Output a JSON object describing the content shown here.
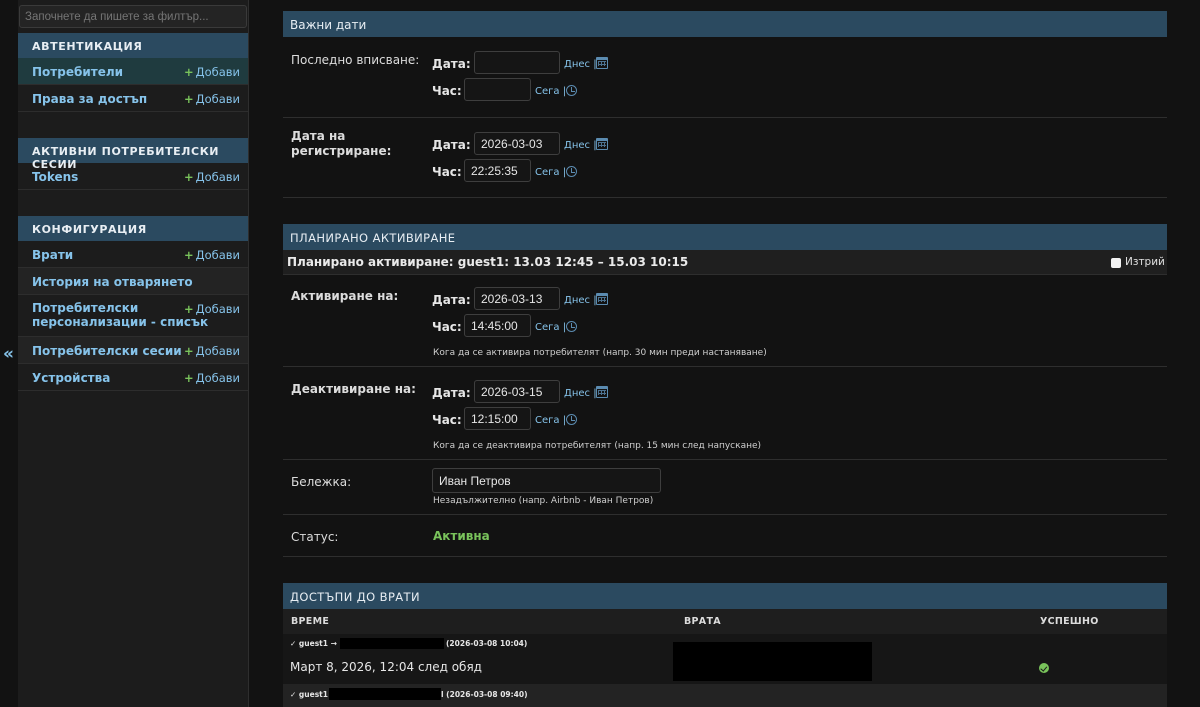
{
  "sidebar": {
    "filter_placeholder": "Започнете да пишете за филтър...",
    "collapse_label": "«",
    "add_label": "Добави",
    "modules": [
      {
        "title": "АВТЕНТИКАЦИЯ",
        "items": [
          {
            "label": "Потребители",
            "selected": true
          },
          {
            "label": "Права за достъп"
          }
        ]
      },
      {
        "title": "АКТИВНИ ПОТРЕБИТЕЛСКИ СЕСИИ",
        "items": [
          {
            "label": "Tokens"
          }
        ]
      },
      {
        "title": "КОНФИГУРАЦИЯ",
        "items": [
          {
            "label": "Врати"
          },
          {
            "label": "История на отварянето"
          },
          {
            "label_line1": "Потребителски",
            "label_line2": "персонализации - списък"
          },
          {
            "label": "Потребителски сесии"
          },
          {
            "label": "Устройства"
          }
        ]
      }
    ]
  },
  "important_dates": {
    "title": "Важни дати",
    "last_login": {
      "label": "Последно вписване:",
      "date_label": "Дата:",
      "date_value": "",
      "time_label": "Час:",
      "time_value": "",
      "today": "Днес",
      "now": "Сега",
      "sep": "|"
    },
    "date_joined": {
      "label_line1": "Дата на",
      "label_line2": "регистриране:",
      "date_label": "Дата:",
      "date_value": "2026-03-03",
      "time_label": "Час:",
      "time_value": "22:25:35",
      "today": "Днес",
      "now": "Сега",
      "sep": "|"
    }
  },
  "scheduled": {
    "title": "ПЛАНИРАНО АКТИВИРАНЕ",
    "entry_title": "Планирано активиране: guest1: 13.03 12:45 – 15.03 10:15",
    "delete_label": "Изтрий",
    "activate": {
      "label": "Активиране на:",
      "date_label": "Дата:",
      "date_value": "2026-03-13",
      "time_label": "Час:",
      "time_value": "14:45:00",
      "today": "Днес",
      "now": "Сега",
      "sep": "|",
      "help": "Кога да се активира потребителят (напр. 30 мин преди настаняване)"
    },
    "deactivate": {
      "label": "Деактивиране на:",
      "date_label": "Дата:",
      "date_value": "2026-03-15",
      "time_label": "Час:",
      "time_value": "12:15:00",
      "today": "Днес",
      "now": "Сега",
      "sep": "|",
      "help": "Кога да се деактивира потребителят (напр. 15 мин след напускане)"
    },
    "note": {
      "label": "Бележка:",
      "value": "Иван Петров",
      "help": "Незадължително (напр. Airbnb - Иван Петров)"
    },
    "status": {
      "label": "Статус:",
      "value": "Активна"
    }
  },
  "door_access": {
    "title": "ДОСТЪПИ ДО ВРАТИ",
    "columns": [
      "ВРЕМЕ",
      "ВРАТА",
      "УСПЕШНО"
    ],
    "rows": [
      {
        "prefix": "✓ guest1 →",
        "stamp": "(2026-03-08 10:04)",
        "time": "Март 8, 2026, 12:04 след обяд",
        "success": true
      },
      {
        "prefix": "✓ guest1 ·",
        "stamp": "l (2026-03-08 09:40)"
      }
    ]
  },
  "colors": {
    "accent": "#2b4a60",
    "link": "#86c3ea",
    "success": "#79c35b"
  }
}
